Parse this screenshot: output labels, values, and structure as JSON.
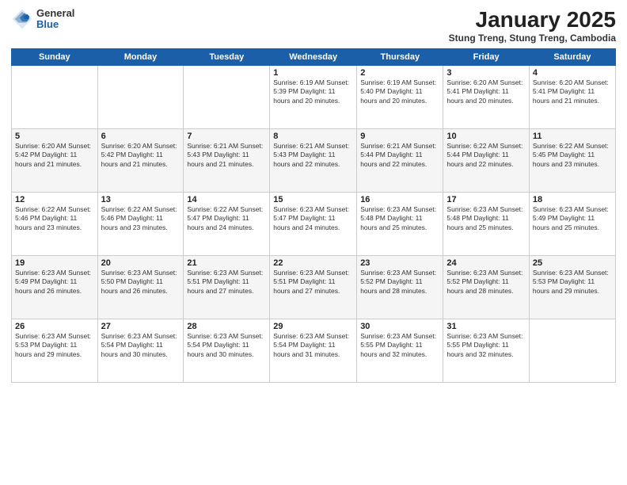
{
  "logo": {
    "general": "General",
    "blue": "Blue"
  },
  "header": {
    "title": "January 2025",
    "subtitle": "Stung Treng, Stung Treng, Cambodia"
  },
  "days_of_week": [
    "Sunday",
    "Monday",
    "Tuesday",
    "Wednesday",
    "Thursday",
    "Friday",
    "Saturday"
  ],
  "weeks": [
    [
      {
        "day": "",
        "info": ""
      },
      {
        "day": "",
        "info": ""
      },
      {
        "day": "",
        "info": ""
      },
      {
        "day": "1",
        "info": "Sunrise: 6:19 AM\nSunset: 5:39 PM\nDaylight: 11 hours\nand 20 minutes."
      },
      {
        "day": "2",
        "info": "Sunrise: 6:19 AM\nSunset: 5:40 PM\nDaylight: 11 hours\nand 20 minutes."
      },
      {
        "day": "3",
        "info": "Sunrise: 6:20 AM\nSunset: 5:41 PM\nDaylight: 11 hours\nand 20 minutes."
      },
      {
        "day": "4",
        "info": "Sunrise: 6:20 AM\nSunset: 5:41 PM\nDaylight: 11 hours\nand 21 minutes."
      }
    ],
    [
      {
        "day": "5",
        "info": "Sunrise: 6:20 AM\nSunset: 5:42 PM\nDaylight: 11 hours\nand 21 minutes."
      },
      {
        "day": "6",
        "info": "Sunrise: 6:20 AM\nSunset: 5:42 PM\nDaylight: 11 hours\nand 21 minutes."
      },
      {
        "day": "7",
        "info": "Sunrise: 6:21 AM\nSunset: 5:43 PM\nDaylight: 11 hours\nand 21 minutes."
      },
      {
        "day": "8",
        "info": "Sunrise: 6:21 AM\nSunset: 5:43 PM\nDaylight: 11 hours\nand 22 minutes."
      },
      {
        "day": "9",
        "info": "Sunrise: 6:21 AM\nSunset: 5:44 PM\nDaylight: 11 hours\nand 22 minutes."
      },
      {
        "day": "10",
        "info": "Sunrise: 6:22 AM\nSunset: 5:44 PM\nDaylight: 11 hours\nand 22 minutes."
      },
      {
        "day": "11",
        "info": "Sunrise: 6:22 AM\nSunset: 5:45 PM\nDaylight: 11 hours\nand 23 minutes."
      }
    ],
    [
      {
        "day": "12",
        "info": "Sunrise: 6:22 AM\nSunset: 5:46 PM\nDaylight: 11 hours\nand 23 minutes."
      },
      {
        "day": "13",
        "info": "Sunrise: 6:22 AM\nSunset: 5:46 PM\nDaylight: 11 hours\nand 23 minutes."
      },
      {
        "day": "14",
        "info": "Sunrise: 6:22 AM\nSunset: 5:47 PM\nDaylight: 11 hours\nand 24 minutes."
      },
      {
        "day": "15",
        "info": "Sunrise: 6:23 AM\nSunset: 5:47 PM\nDaylight: 11 hours\nand 24 minutes."
      },
      {
        "day": "16",
        "info": "Sunrise: 6:23 AM\nSunset: 5:48 PM\nDaylight: 11 hours\nand 25 minutes."
      },
      {
        "day": "17",
        "info": "Sunrise: 6:23 AM\nSunset: 5:48 PM\nDaylight: 11 hours\nand 25 minutes."
      },
      {
        "day": "18",
        "info": "Sunrise: 6:23 AM\nSunset: 5:49 PM\nDaylight: 11 hours\nand 25 minutes."
      }
    ],
    [
      {
        "day": "19",
        "info": "Sunrise: 6:23 AM\nSunset: 5:49 PM\nDaylight: 11 hours\nand 26 minutes."
      },
      {
        "day": "20",
        "info": "Sunrise: 6:23 AM\nSunset: 5:50 PM\nDaylight: 11 hours\nand 26 minutes."
      },
      {
        "day": "21",
        "info": "Sunrise: 6:23 AM\nSunset: 5:51 PM\nDaylight: 11 hours\nand 27 minutes."
      },
      {
        "day": "22",
        "info": "Sunrise: 6:23 AM\nSunset: 5:51 PM\nDaylight: 11 hours\nand 27 minutes."
      },
      {
        "day": "23",
        "info": "Sunrise: 6:23 AM\nSunset: 5:52 PM\nDaylight: 11 hours\nand 28 minutes."
      },
      {
        "day": "24",
        "info": "Sunrise: 6:23 AM\nSunset: 5:52 PM\nDaylight: 11 hours\nand 28 minutes."
      },
      {
        "day": "25",
        "info": "Sunrise: 6:23 AM\nSunset: 5:53 PM\nDaylight: 11 hours\nand 29 minutes."
      }
    ],
    [
      {
        "day": "26",
        "info": "Sunrise: 6:23 AM\nSunset: 5:53 PM\nDaylight: 11 hours\nand 29 minutes."
      },
      {
        "day": "27",
        "info": "Sunrise: 6:23 AM\nSunset: 5:54 PM\nDaylight: 11 hours\nand 30 minutes."
      },
      {
        "day": "28",
        "info": "Sunrise: 6:23 AM\nSunset: 5:54 PM\nDaylight: 11 hours\nand 30 minutes."
      },
      {
        "day": "29",
        "info": "Sunrise: 6:23 AM\nSunset: 5:54 PM\nDaylight: 11 hours\nand 31 minutes."
      },
      {
        "day": "30",
        "info": "Sunrise: 6:23 AM\nSunset: 5:55 PM\nDaylight: 11 hours\nand 32 minutes."
      },
      {
        "day": "31",
        "info": "Sunrise: 6:23 AM\nSunset: 5:55 PM\nDaylight: 11 hours\nand 32 minutes."
      },
      {
        "day": "",
        "info": ""
      }
    ]
  ]
}
